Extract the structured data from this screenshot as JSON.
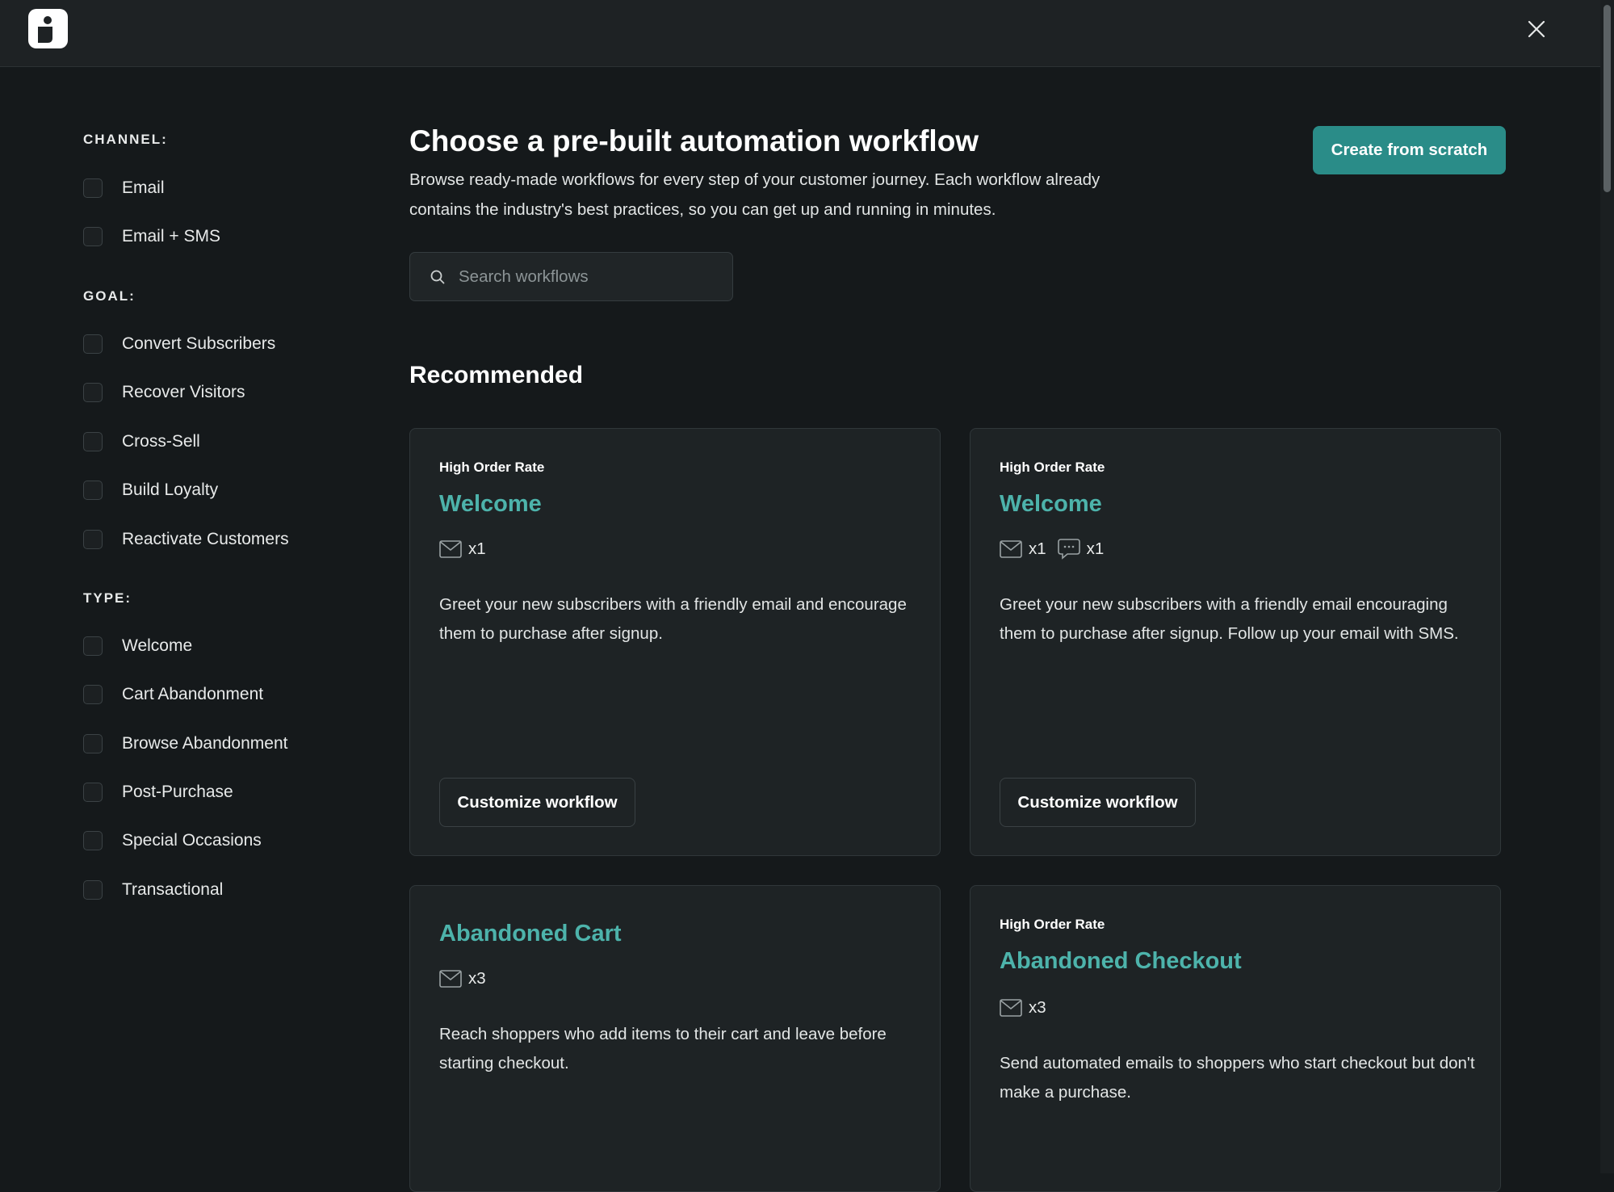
{
  "header": {
    "close_icon": "close-icon",
    "logo_icon": "klaviyo-style-logo"
  },
  "filters": {
    "channel": {
      "title": "CHANNEL:",
      "items": [
        "Email",
        "Email + SMS"
      ]
    },
    "goal": {
      "title": "GOAL:",
      "items": [
        "Convert Subscribers",
        "Recover Visitors",
        "Cross-Sell",
        "Build Loyalty",
        "Reactivate Customers"
      ]
    },
    "type": {
      "title": "TYPE:",
      "items": [
        "Welcome",
        "Cart Abandonment",
        "Browse Abandonment",
        "Post-Purchase",
        "Special Occasions",
        "Transactional"
      ]
    }
  },
  "main": {
    "title": "Choose a pre-built automation workflow",
    "description": "Browse ready-made workflows for every step of your customer journey. Each workflow already contains the industry's best practices, so you can get up and running in minutes.",
    "create_button": "Create from scratch",
    "search": {
      "placeholder": "Search workflows"
    },
    "section_title": "Recommended"
  },
  "cards": [
    {
      "tag": "High Order Rate",
      "title": "Welcome",
      "email_count": "x1",
      "description": "Greet your new subscribers with a friendly email and encourage them to purchase after signup.",
      "button": "Customize workflow"
    },
    {
      "tag": "High Order Rate",
      "title": "Welcome",
      "email_count": "x1",
      "sms_count": "x1",
      "description": "Greet your new subscribers with a friendly email encouraging them to purchase after signup. Follow up your email with SMS.",
      "button": "Customize workflow"
    },
    {
      "title": "Abandoned Cart",
      "email_count": "x3",
      "description": "Reach shoppers who add items to their cart and leave before starting checkout."
    },
    {
      "tag": "High Order Rate",
      "title": "Abandoned Checkout",
      "email_count": "x3",
      "description": "Send automated emails to shoppers who start checkout but don't make a purchase."
    }
  ],
  "colors": {
    "accent": "#2a8c88",
    "card_title": "#4db3ab",
    "background": "#15191b"
  }
}
